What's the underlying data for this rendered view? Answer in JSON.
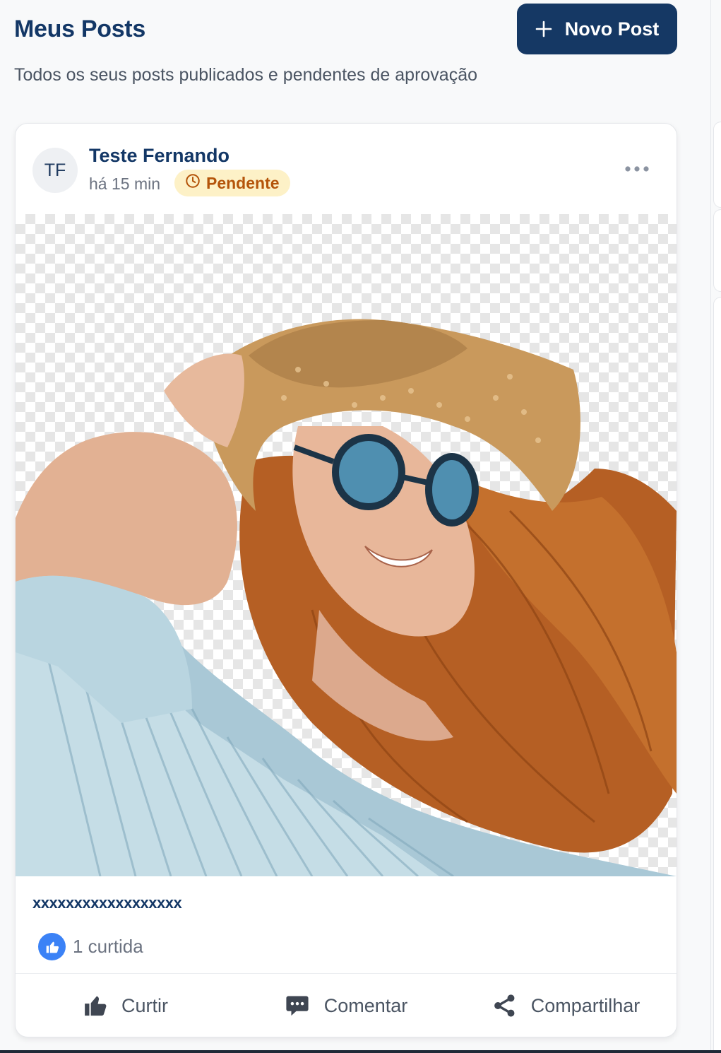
{
  "header": {
    "title": "Meus Posts",
    "subtitle": "Todos os seus posts publicados e pendentes de aprovação",
    "new_post_label": "Novo Post"
  },
  "post": {
    "avatar_initials": "TF",
    "author": "Teste Fernando",
    "time": "há 15 min",
    "status": "Pendente",
    "caption": "xxxxxxxxxxxxxxxxxx",
    "likes": "1 curtida",
    "actions": {
      "like": "Curtir",
      "comment": "Comentar",
      "share": "Compartilhar"
    }
  },
  "colors": {
    "primary": "#153864",
    "title": "#133766",
    "pending_bg": "#fdf1c7",
    "pending_text": "#b4540a",
    "like_blue": "#3b82f6"
  },
  "icons": {
    "new_post": "plus-icon",
    "status": "clock-icon",
    "more": "more-horizontal-icon",
    "like_badge": "thumbs-up-icon",
    "like": "thumbs-up-icon",
    "comment": "comment-icon",
    "share": "share-icon"
  }
}
